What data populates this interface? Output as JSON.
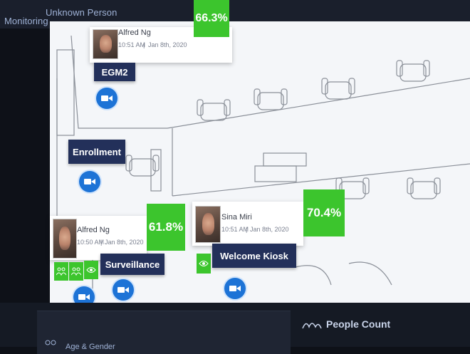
{
  "nav": {
    "monitoring": "Monitoring",
    "unknown_person": "Unknown Person"
  },
  "detections": [
    {
      "name": "Alfred Ng",
      "time": "10:51 AM",
      "date": "Jan 8th, 2020",
      "score": "66.3%"
    },
    {
      "name": "Alfred Ng",
      "time": "10:50 AM",
      "date": "Jan 8th, 2020",
      "score": "61.8%"
    },
    {
      "name": "Sina Miri",
      "time": "10:51 AM",
      "date": "Jan 8th, 2020",
      "score": "70.4%"
    }
  ],
  "cameras": {
    "egm2": "EGM2",
    "enrollment": "Enrollment",
    "surveillance": "Surveillance",
    "welcome_kiosk": "Welcome Kiosk"
  },
  "bottom": {
    "age_gender": "Age & Gender",
    "people_count": "People Count"
  },
  "colors": {
    "score_green": "#3cc52d",
    "camera_blue": "#1d73d6",
    "label_navy": "#23305a"
  },
  "icons": [
    "video-camera-icon",
    "eye-icon",
    "people-icon",
    "people-count-icon"
  ]
}
